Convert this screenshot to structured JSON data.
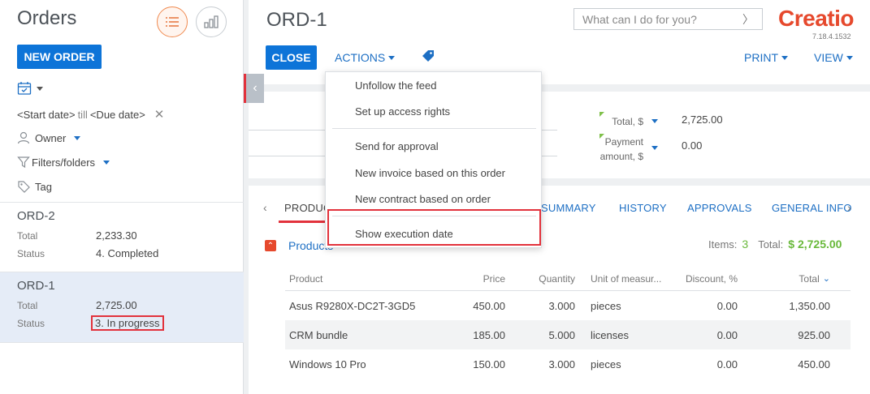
{
  "left": {
    "title": "Orders",
    "new_order_label": "NEW ORDER",
    "date_filter": {
      "start": "<Start date>",
      "till": "till",
      "due": "<Due date>"
    },
    "owner_label": "Owner",
    "filters_label": "Filters/folders",
    "tag_label": "Tag",
    "records": [
      {
        "title": "ORD-2",
        "total_label": "Total",
        "total_value": "2,233.30",
        "status_label": "Status",
        "status_value": "4. Completed"
      },
      {
        "title": "ORD-1",
        "total_label": "Total",
        "total_value": "2,725.00",
        "status_label": "Status",
        "status_value": "3. In progress"
      }
    ]
  },
  "header": {
    "title": "ORD-1",
    "close_label": "CLOSE",
    "actions_label": "ACTIONS",
    "search_placeholder": "What can I do for you?",
    "logo_text": "Creatio",
    "version": "7.18.4.1532",
    "print_label": "PRINT",
    "view_label": "VIEW"
  },
  "summary": {
    "total_label": "Total, $",
    "total_value": "2,725.00",
    "payment_label_1": "Payment",
    "payment_label_2": "amount, $",
    "payment_value": "0.00"
  },
  "menu": {
    "items": [
      "Unfollow the feed",
      "Set up access rights",
      "Send for approval",
      "New invoice based on this order",
      "New contract based on order",
      "Show execution date"
    ]
  },
  "tabs": {
    "items": [
      "PRODUC",
      "SUMMARY",
      "HISTORY",
      "APPROVALS",
      "GENERAL INFO"
    ]
  },
  "products": {
    "title": "Products",
    "items_label": "Items:",
    "items_count": "3",
    "total_label": "Total:",
    "total_value": "$ 2,725.00",
    "columns": [
      "Product",
      "Price",
      "Quantity",
      "Unit of measur...",
      "Discount, %",
      "Total"
    ],
    "rows": [
      [
        "Asus R9280X-DC2T-3GD5",
        "450.00",
        "3.000",
        "pieces",
        "0.00",
        "1,350.00"
      ],
      [
        "CRM bundle",
        "185.00",
        "5.000",
        "licenses",
        "0.00",
        "925.00"
      ],
      [
        "Windows 10 Pro",
        "150.00",
        "3.000",
        "pieces",
        "0.00",
        "450.00"
      ]
    ]
  },
  "colors": {
    "accent": "#0d74d8",
    "link": "#1d6fc4",
    "highlight": "#e2323c",
    "brand": "#e6492d",
    "positive": "#69b93b"
  },
  "icons": [
    "list-view-icon",
    "chart-view-icon",
    "calendar-icon",
    "user-icon",
    "filter-icon",
    "tag-icon",
    "search-arrow-icon",
    "collapse-panel-icon",
    "tab-left-arrow-icon",
    "tab-right-arrow-icon",
    "sort-desc-icon",
    "collapse-group-icon"
  ]
}
